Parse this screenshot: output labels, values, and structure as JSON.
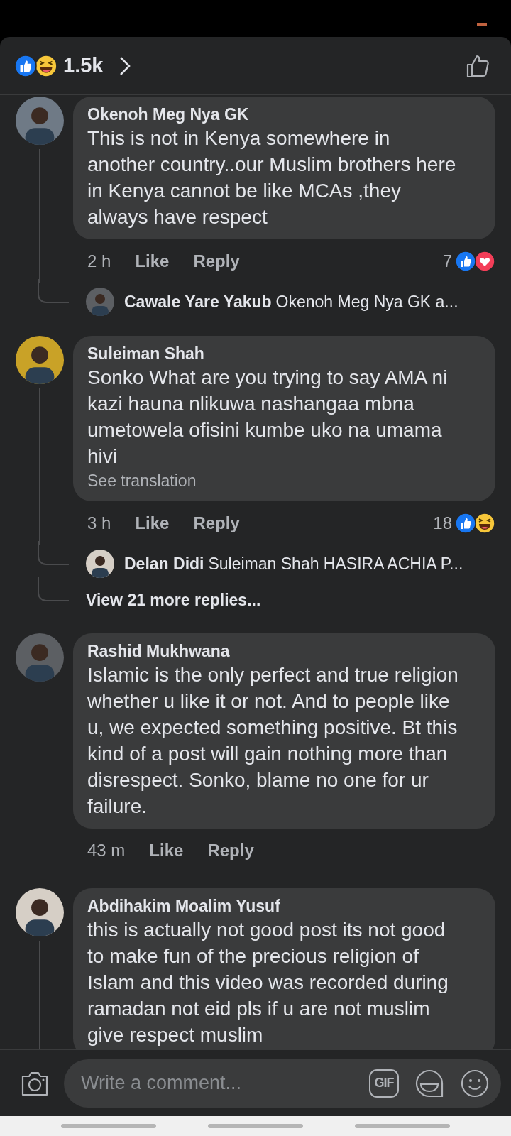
{
  "header": {
    "reactions": [
      {
        "kind": "like"
      },
      {
        "kind": "haha"
      }
    ],
    "count": "1.5k"
  },
  "comments": [
    {
      "author": "Okenoh Meg Nya GK",
      "text": "This is not in Kenya somewhere in another country..our Muslim brothers here in Kenya cannot be like MCAs ,they always have respect",
      "time": "2 h",
      "like": "Like",
      "reply": "Reply",
      "reaction_count": "7",
      "reactions": [
        {
          "kind": "like"
        },
        {
          "kind": "love"
        }
      ],
      "threaded": true,
      "replies": [
        {
          "author": "Cawale Yare Yakub",
          "preview": "Okenoh Meg Nya GK a..."
        }
      ]
    },
    {
      "author": "Suleiman Shah",
      "text": "Sonko What are you trying to say AMA ni kazi hauna nlikuwa nashangaa mbna umetowela ofisini kumbe uko na umama hivi",
      "translation": "See translation",
      "time": "3 h",
      "like": "Like",
      "reply": "Reply",
      "reaction_count": "18",
      "reactions": [
        {
          "kind": "like"
        },
        {
          "kind": "haha"
        }
      ],
      "threaded": true,
      "replies": [
        {
          "author": "Delan Didi",
          "preview": "Suleiman Shah HASIRA ACHIA P..."
        }
      ],
      "more_replies": "View 21 more replies..."
    },
    {
      "author": "Rashid Mukhwana",
      "text": "Islamic is the only perfect and true religion whether u like it or not.  And  to people like u, we expected something positive. Bt this kind of a post will gain nothing more than disrespect. Sonko, blame no one for ur failure.",
      "time": "43 m",
      "like": "Like",
      "reply": "Reply",
      "threaded": false
    },
    {
      "author": "Abdihakim Moalim Yusuf",
      "text": "this is actually not good post its not good  to make fun of the precious religion of Islam and this video was recorded during ramadan not eid pls if u are not muslim give respect muslim",
      "threaded": true
    }
  ],
  "composer": {
    "placeholder": "Write a comment...",
    "gif_label": "GIF"
  }
}
